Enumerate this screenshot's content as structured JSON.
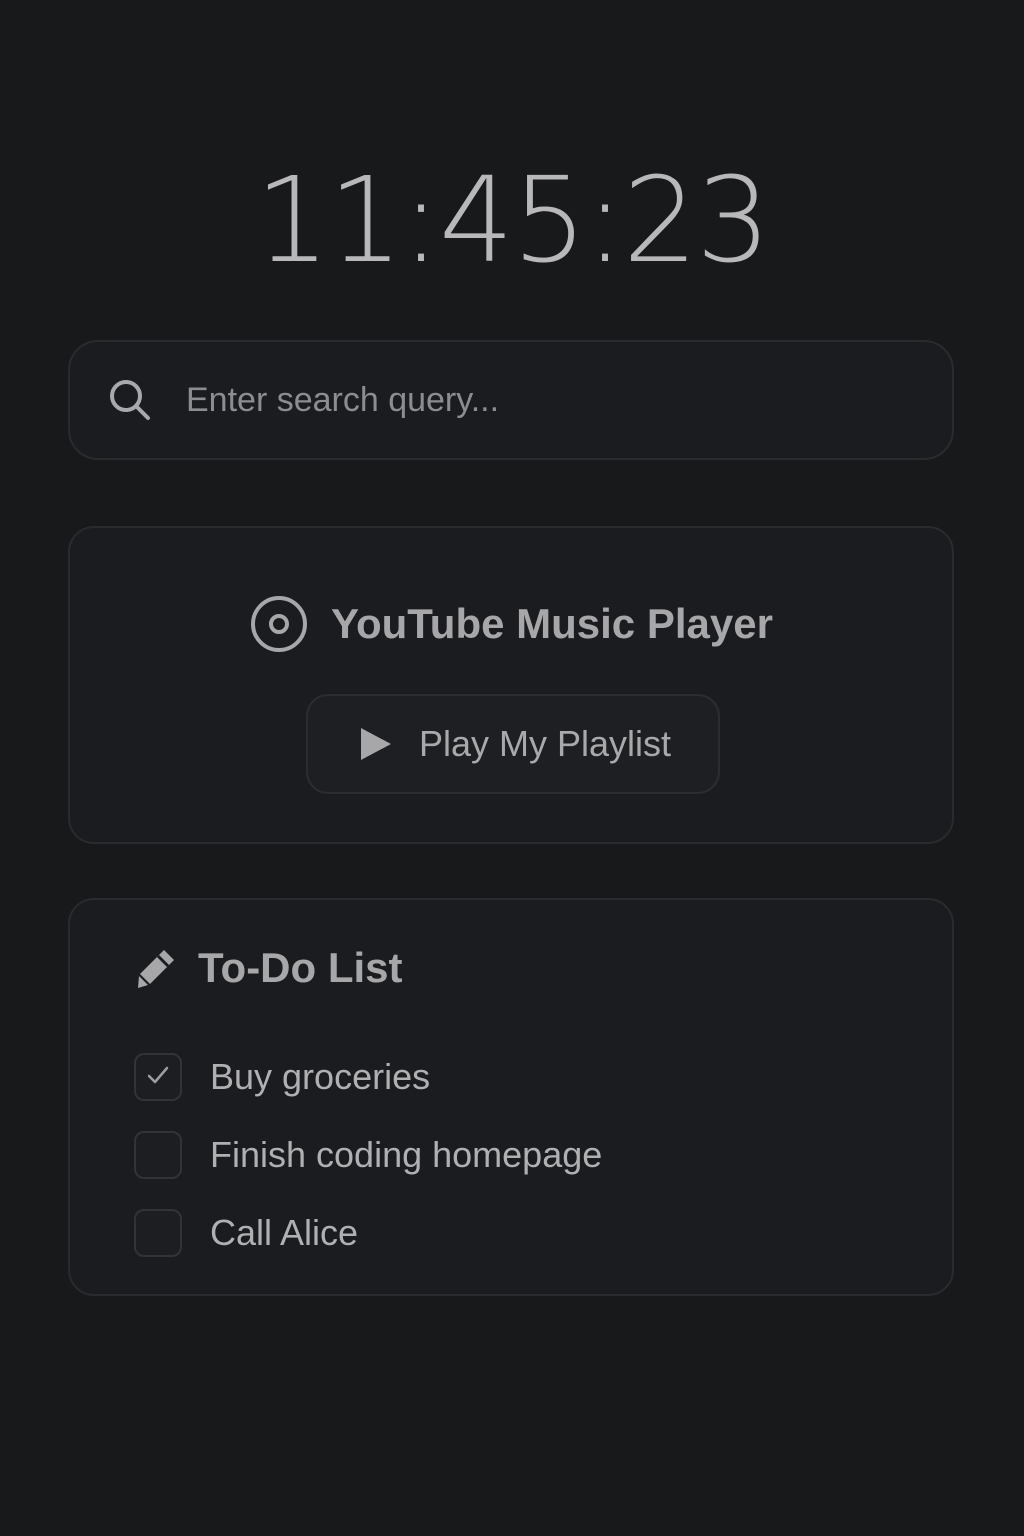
{
  "clock": {
    "time": "11:45:23"
  },
  "search": {
    "placeholder": "Enter search query...",
    "value": "",
    "icon": "search-icon"
  },
  "music": {
    "title": "YouTube Music Player",
    "icon": "disc-icon",
    "button": {
      "label": "Play My Playlist",
      "icon": "play-icon"
    }
  },
  "todo": {
    "title": "To-Do List",
    "icon": "pencil-icon",
    "items": [
      {
        "label": "Buy groceries",
        "checked": true
      },
      {
        "label": "Finish coding homepage",
        "checked": false
      },
      {
        "label": "Call Alice",
        "checked": false
      }
    ]
  },
  "colors": {
    "background": "#18191b",
    "card": "#1b1c1f",
    "border": "#2a2b2e",
    "text": "#b4b4b6"
  }
}
